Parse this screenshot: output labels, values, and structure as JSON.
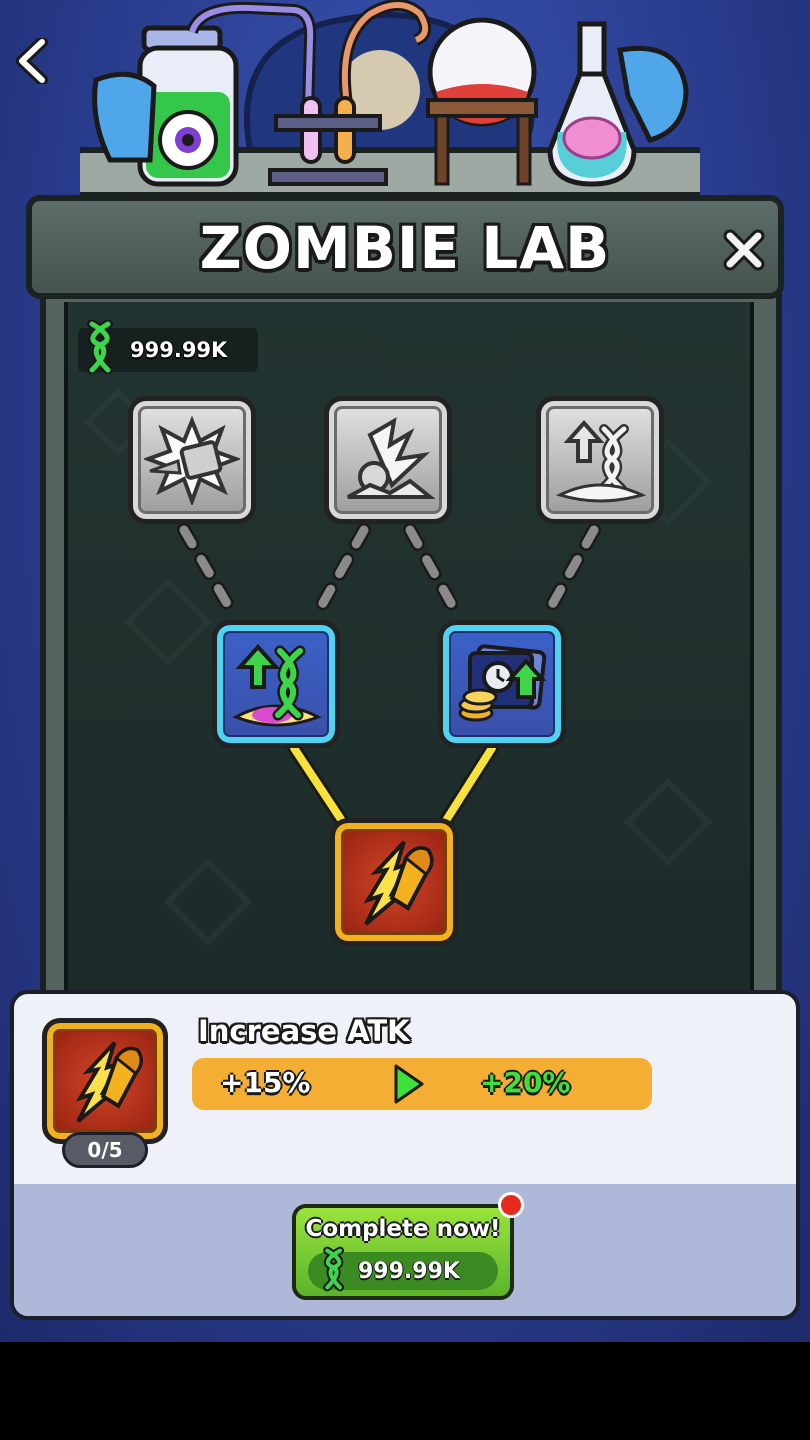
{
  "header": {
    "title": "ZOMBIE LAB"
  },
  "currency": {
    "amount": "999.99K",
    "icon": "dna-icon"
  },
  "tree": {
    "nodes": [
      {
        "id": "bullet-impact",
        "icon": "explosion-bullet-icon",
        "state": "locked"
      },
      {
        "id": "lightning-crash",
        "icon": "lightning-timer-icon",
        "state": "locked"
      },
      {
        "id": "dna-boost-locked",
        "icon": "dna-upgrade-icon",
        "state": "locked"
      },
      {
        "id": "dna-boost",
        "icon": "dna-upgrade-icon",
        "state": "available"
      },
      {
        "id": "time-coins",
        "icon": "timer-coins-icon",
        "state": "available"
      },
      {
        "id": "atk-bullet",
        "icon": "bullet-icon",
        "state": "selected"
      }
    ]
  },
  "selected_skill": {
    "name": "Increase ATK",
    "level": "0/5",
    "current_value": "+15%",
    "next_value": "+20%",
    "icon": "bullet-icon"
  },
  "complete_button": {
    "label": "Complete now!",
    "cost": "999.99K"
  },
  "colors": {
    "accent_gold": "#f2b21d",
    "available_cyan": "#4fd3f0",
    "button_green": "#5bb52a",
    "stat_bar": "#f4ae33",
    "next_value_green": "#3ee03a"
  }
}
